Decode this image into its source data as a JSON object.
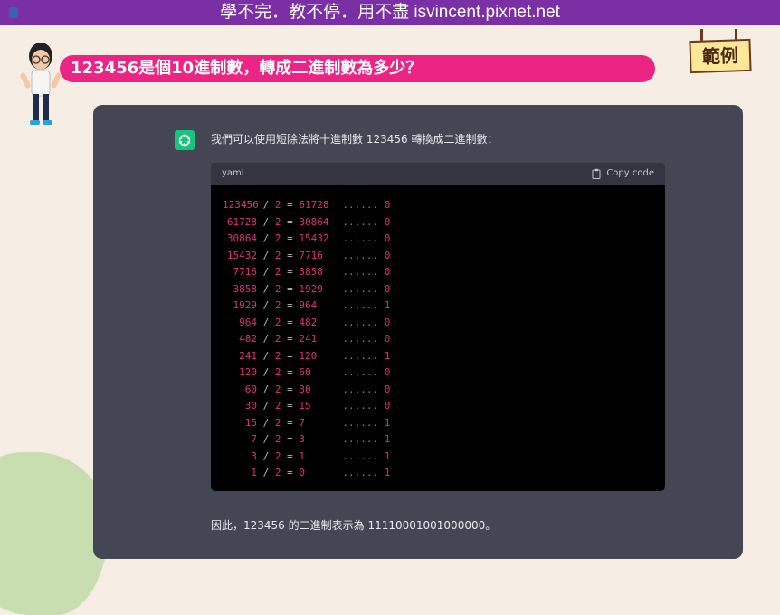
{
  "header": {
    "title": "學不完．教不停．用不盡 isvincent.pixnet.net"
  },
  "question": {
    "text": "123456是個10進制數，轉成二進制數為多少？"
  },
  "badge": {
    "text": "範例"
  },
  "answer": {
    "intro": "我們可以使用短除法將十進制數 123456 轉換成二進制數：",
    "code": {
      "language": "yaml",
      "copy_label": "Copy code",
      "rows": [
        {
          "n": "123456",
          "q": "61728",
          "r": "0"
        },
        {
          "n": "61728",
          "q": "30864",
          "r": "0"
        },
        {
          "n": "30864",
          "q": "15432",
          "r": "0"
        },
        {
          "n": "15432",
          "q": "7716",
          "r": "0"
        },
        {
          "n": "7716",
          "q": "3858",
          "r": "0"
        },
        {
          "n": "3858",
          "q": "1929",
          "r": "0"
        },
        {
          "n": "1929",
          "q": "964",
          "r": "1"
        },
        {
          "n": "964",
          "q": "482",
          "r": "0"
        },
        {
          "n": "482",
          "q": "241",
          "r": "0"
        },
        {
          "n": "241",
          "q": "120",
          "r": "1"
        },
        {
          "n": "120",
          "q": "60",
          "r": "0"
        },
        {
          "n": "60",
          "q": "30",
          "r": "0"
        },
        {
          "n": "30",
          "q": "15",
          "r": "0"
        },
        {
          "n": "15",
          "q": "7",
          "r": "1"
        },
        {
          "n": "7",
          "q": "3",
          "r": "1"
        },
        {
          "n": "3",
          "q": "1",
          "r": "1"
        },
        {
          "n": "1",
          "q": "0",
          "r": "1"
        }
      ],
      "divisor": "2",
      "dots": "......"
    },
    "conclusion": "因此，123456 的二進制表示為 11110001001000000。"
  },
  "colors": {
    "topbar": "#7a2fa5",
    "question_bg": "#ec2483",
    "card_bg": "#444654",
    "code_number": "#df3079",
    "code_dots": "#14b86a"
  }
}
